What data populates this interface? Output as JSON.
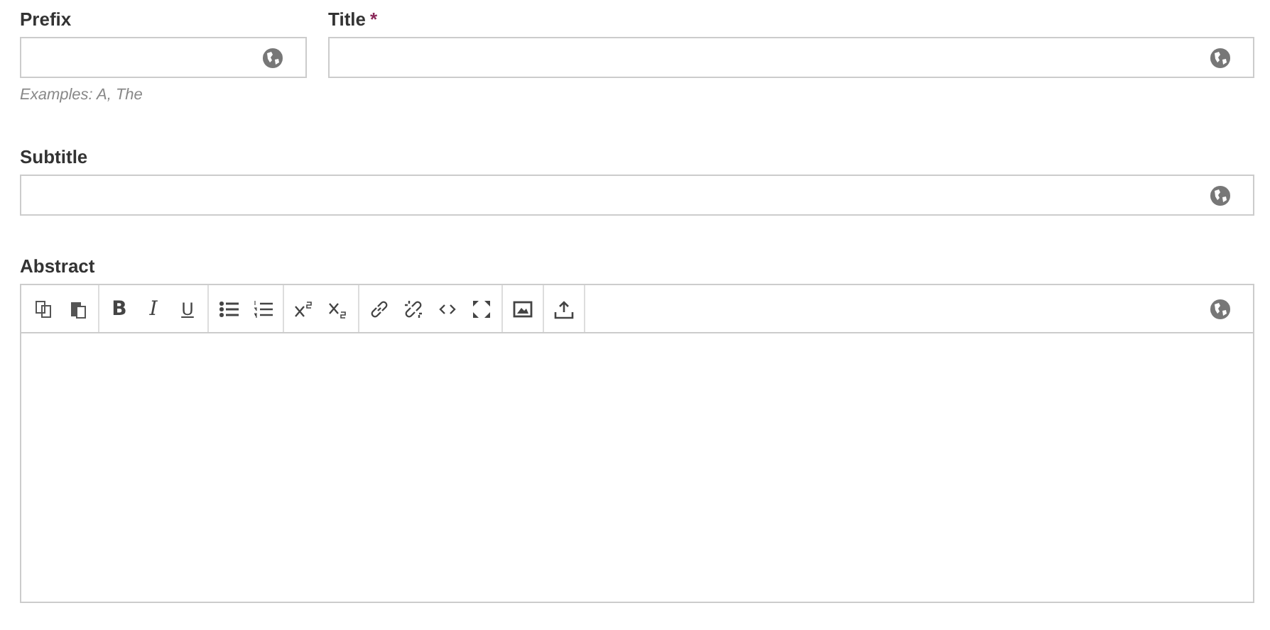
{
  "rows": [
    [
      {
        "label": "Prefix",
        "hint": "Examples: A, The"
      },
      {
        "label": "Title",
        "required_mark": "*"
      }
    ],
    [
      {
        "label": "Subtitle"
      }
    ]
  ],
  "abstract": {
    "label": "Abstract",
    "toolbar": [
      [
        {
          "kind": "copy"
        },
        {
          "kind": "paste"
        }
      ],
      [
        {
          "kind": "bold",
          "label": "B"
        },
        {
          "kind": "italic",
          "label": "I"
        },
        {
          "kind": "underline",
          "label": "U"
        }
      ],
      [
        {
          "kind": "bullets"
        },
        {
          "kind": "numbers"
        }
      ],
      [
        {
          "kind": "superscript"
        },
        {
          "kind": "subscript"
        }
      ],
      [
        {
          "kind": "link"
        },
        {
          "kind": "unlink"
        },
        {
          "kind": "code"
        },
        {
          "kind": "fullscreen"
        }
      ],
      [
        {
          "kind": "image"
        }
      ],
      [
        {
          "kind": "upload"
        }
      ]
    ]
  }
}
